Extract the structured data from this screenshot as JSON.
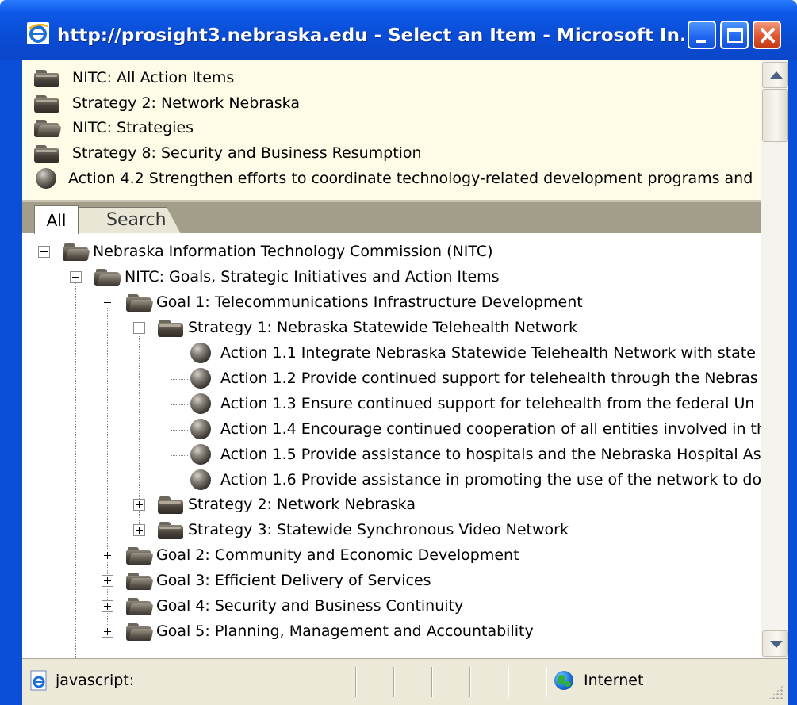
{
  "window": {
    "title": "http://prosight3.nebraska.edu - Select an Item - Microsoft In...",
    "controls": [
      "minimize",
      "maximize",
      "close"
    ]
  },
  "history": [
    {
      "label": "NITC: All Action Items",
      "icon": "folder-closed-icon"
    },
    {
      "label": "Strategy 2: Network Nebraska",
      "icon": "folder-closed-icon"
    },
    {
      "label": "NITC: Strategies",
      "icon": "folder-open-icon"
    },
    {
      "label": "Strategy 8: Security and Business Resumption",
      "icon": "folder-closed-icon"
    },
    {
      "label": "Action 4.2 Strengthen efforts to coordinate technology-related development programs and",
      "icon": "action-ball-icon"
    }
  ],
  "tabs": [
    {
      "label": "All",
      "selected": true
    },
    {
      "label": "Search",
      "selected": false
    }
  ],
  "tree": {
    "root": {
      "label": "Nebraska Information Technology Commission (NITC)",
      "expanded": true
    },
    "goals_group": {
      "label": "NITC: Goals, Strategic Initiatives and Action Items",
      "expanded": true
    },
    "goal1": {
      "label": "Goal 1: Telecommunications Infrastructure Development",
      "expanded": true
    },
    "strategy1": {
      "label": "Strategy 1: Nebraska Statewide Telehealth Network",
      "expanded": true
    },
    "actions": [
      "Action 1.1 Integrate Nebraska Statewide Telehealth Network with state",
      "Action 1.2 Provide continued support for telehealth through the Nebras",
      "Action 1.3 Ensure continued support for telehealth from the federal Un",
      "Action 1.4 Encourage continued cooperation of all entities involved in th",
      "Action 1.5 Provide assistance to hospitals and the Nebraska Hospital As",
      "Action 1.6 Provide assistance in promoting the use of the network to do"
    ],
    "strategies_collapsed": [
      "Strategy 2: Network Nebraska",
      "Strategy 3: Statewide Synchronous Video Network"
    ],
    "goals_collapsed": [
      "Goal 2: Community and Economic Development",
      "Goal 3: Efficient Delivery of Services",
      "Goal 4: Security and Business Continuity",
      "Goal 5: Planning, Management and Accountability"
    ]
  },
  "statusbar": {
    "text": "javascript:",
    "zone": "Internet"
  }
}
